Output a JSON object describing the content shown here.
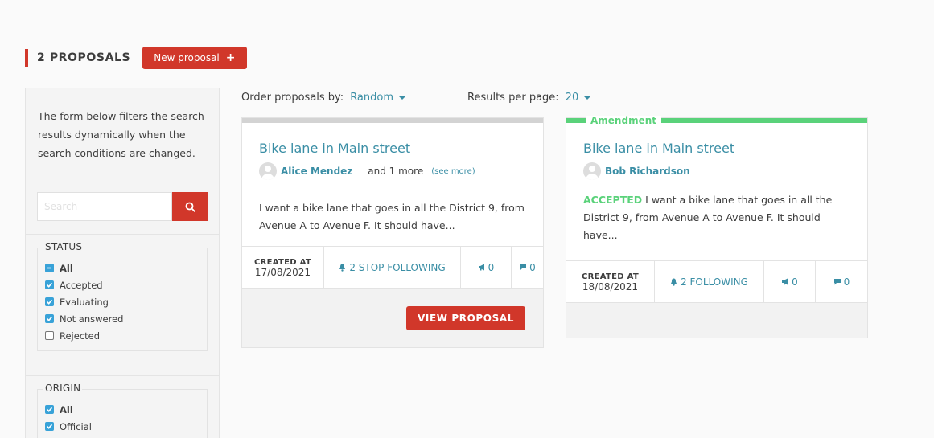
{
  "header": {
    "title": "2 PROPOSALS",
    "new_button": "New proposal",
    "new_button_icon": "plus-icon"
  },
  "sidebar": {
    "intro": "The form below filters the search results dynamically when the search conditions are changed.",
    "search": {
      "placeholder": "Search",
      "button_icon": "search-icon"
    },
    "status": {
      "legend": "STATUS",
      "items": [
        {
          "label": "All",
          "state": "indeterminate"
        },
        {
          "label": "Accepted",
          "state": "checked"
        },
        {
          "label": "Evaluating",
          "state": "checked"
        },
        {
          "label": "Not answered",
          "state": "checked"
        },
        {
          "label": "Rejected",
          "state": "unchecked"
        }
      ]
    },
    "origin": {
      "legend": "ORIGIN",
      "items": [
        {
          "label": "All",
          "state": "checked"
        },
        {
          "label": "Official",
          "state": "checked"
        }
      ]
    }
  },
  "toolbar": {
    "order_label": "Order proposals by:",
    "order_value": "Random",
    "per_page_label": "Results per page:",
    "per_page_value": "20"
  },
  "cards": [
    {
      "title": "Bike lane in Main street",
      "author": "Alice Mendez",
      "more": "and 1 more",
      "see_more": "(see more)",
      "status_badge": "",
      "description": "I want a bike lane that goes in all the District 9, from Avenue A to Avenue F. It should have...",
      "created_label": "CREATED AT",
      "created_date": "17/08/2021",
      "follow_label": "2 STOP FOLLOWING",
      "supports": "0",
      "comments": "0",
      "view_button": "VIEW PROPOSAL"
    },
    {
      "amend_label": "Amendment",
      "title": "Bike lane in Main street",
      "author": "Bob Richardson",
      "status_badge": "ACCEPTED",
      "description": "I want a bike lane that goes in all the District 9, from Avenue A to Avenue F. It should have...",
      "created_label": "CREATED AT",
      "created_date": "18/08/2021",
      "follow_label": "2 FOLLOWING",
      "supports": "0",
      "comments": "0"
    }
  ],
  "colors": {
    "primary": "#d1372a",
    "link": "#3a8ea5",
    "success": "#5ad27a",
    "checkbox": "#38a2d8"
  }
}
